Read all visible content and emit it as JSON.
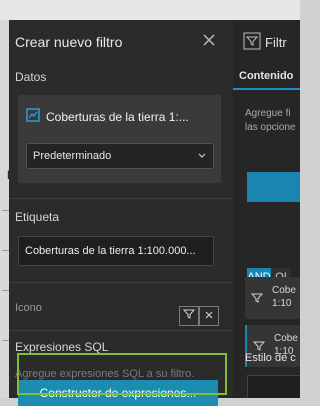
{
  "map": {
    "edge_label": "L"
  },
  "create_filter": {
    "title": "Crear nuevo filtro",
    "close_icon": "close-icon",
    "data_section": {
      "label": "Datos",
      "layer_name": "Coberturas de la tierra 1:...",
      "layer_icon": "layer-icon",
      "select_value": "Predeterminado"
    },
    "label_section": {
      "label": "Etiqueta",
      "value": "Coberturas de la tierra 1:100.000..."
    },
    "icon_section": {
      "label": "Icono",
      "filter_icon": "filter-icon",
      "clear_icon": "close-icon"
    },
    "sql_section": {
      "label": "Expresiones SQL",
      "hint": "Agregue expresiones SQL a su filtro.",
      "builder_button": "Constructor de expresiones..."
    }
  },
  "side_panel": {
    "header": "Filtr",
    "tab": "Contenido",
    "desc_line1": "Agregue fi",
    "desc_line2": "las opcione",
    "and_label": "AND",
    "or_label": "OI",
    "conditions": [
      {
        "line1": "Cobe",
        "line2": "1:10"
      },
      {
        "line1": "Cobe",
        "line2": "1:10"
      }
    ],
    "style_label": "Estilo de c"
  },
  "colors": {
    "accent": "#1c8db1",
    "panel_bg": "#2b2b2b",
    "highlight": "#7fbf3a"
  }
}
